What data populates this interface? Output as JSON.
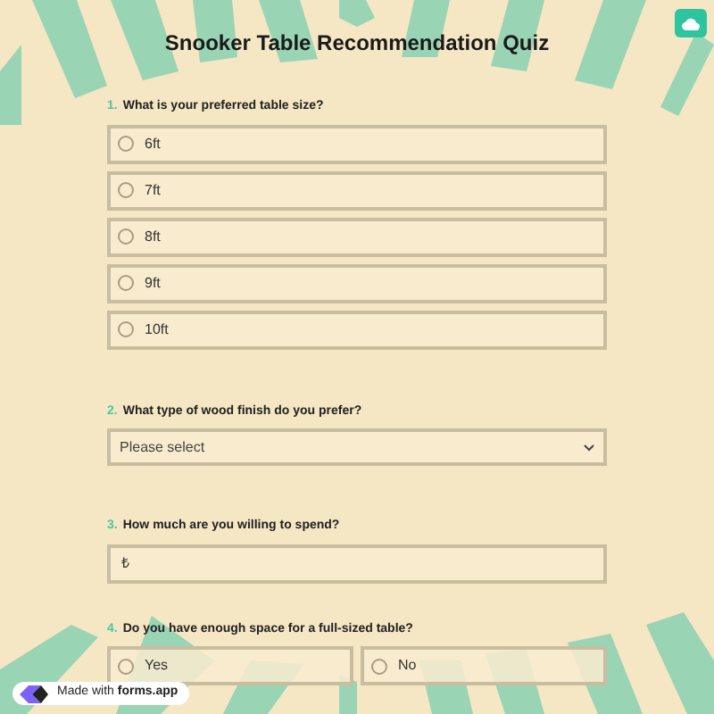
{
  "title": "Snooker Table Recommendation Quiz",
  "questions": [
    {
      "kind": "radio",
      "number": "1.",
      "label": "What is your preferred table size?",
      "options": [
        {
          "label": "6ft",
          "selected": false
        },
        {
          "label": "7ft",
          "selected": false
        },
        {
          "label": "8ft",
          "selected": false
        },
        {
          "label": "9ft",
          "selected": false
        },
        {
          "label": "10ft",
          "selected": false
        }
      ]
    },
    {
      "kind": "select",
      "number": "2.",
      "label": "What type of wood finish do you prefer?",
      "placeholder": "Please select"
    },
    {
      "kind": "input",
      "number": "3.",
      "label": "How much are you willing to spend?",
      "prefix": "₺"
    },
    {
      "kind": "radio_row",
      "number": "4.",
      "label": "Do you have enough space for a full-sized table?",
      "options": [
        {
          "label": "Yes",
          "selected": false
        },
        {
          "label": "No",
          "selected": false
        }
      ]
    }
  ],
  "badge": {
    "text": "Made with **forms.app**"
  }
}
